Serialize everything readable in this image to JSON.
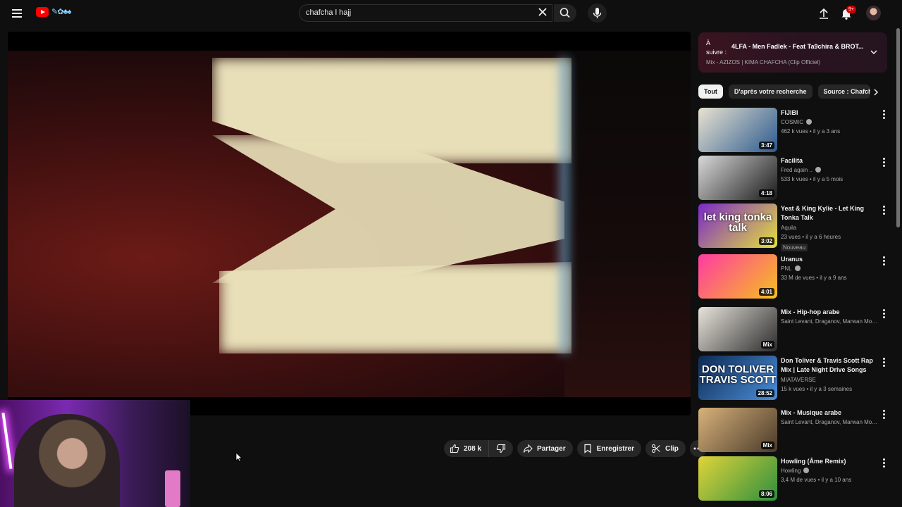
{
  "search": {
    "value": "chafcha l hajj"
  },
  "header": {
    "notification_count": "9+"
  },
  "actions": {
    "likes": "208 k",
    "share_label": "Partager",
    "save_label": "Enregistrer",
    "clip_label": "Clip"
  },
  "up_next": {
    "label": "À suivre :",
    "title": "4LFA - Men Fadlek - Feat Ta9chira & BROT...",
    "playlist": "Mix - AZIZOS | KIMA CHAFCHA (Clip Officiel)"
  },
  "chips": [
    "Tout",
    "D'après votre recherche",
    "Source : Chafcha"
  ],
  "recommendations": [
    {
      "title": "FIJIBI",
      "channel": "COSMIC",
      "verified": true,
      "meta": "462 k vues • il y a 3 ans",
      "duration": "3:47",
      "thumb_colors": [
        "#e9e3d1",
        "#2c5a8f"
      ]
    },
    {
      "title": "Facilita",
      "channel": "Fred again ..",
      "verified": true,
      "meta": "533 k vues • il y a 5 mois",
      "duration": "4:18",
      "thumb_colors": [
        "#d9d9d9",
        "#1a1a1a"
      ]
    },
    {
      "title": "Yeat & King Kylie - Let King Tonka Talk",
      "channel": "Aquila",
      "verified": false,
      "meta": "23 vues • il y a 6 heures",
      "duration": "3:02",
      "badge": "Nouveau",
      "thumb_text": "let king tonka talk",
      "thumb_colors": [
        "#7a28c9",
        "#e6e13a"
      ]
    },
    {
      "title": "Uranus",
      "channel": "PNL",
      "verified": true,
      "meta": "33 M de vues • il y a 9 ans",
      "duration": "4:01",
      "thumb_colors": [
        "#ff3aa3",
        "#f6c11e"
      ]
    },
    {
      "title": "Mix - Hip-hop arabe",
      "channel": "Saint Levant, Draganov, Marwan Moussa...",
      "verified": false,
      "meta": "",
      "duration": "Mix",
      "thumb_colors": [
        "#e8e4dc",
        "#2c2c2c"
      ]
    },
    {
      "title": "Don Toliver & Travis Scott Rap Mix | Late Night Drive Songs",
      "channel": "MIATAVERSE",
      "verified": false,
      "meta": "15 k vues • il y a 3 semaines",
      "duration": "28:52",
      "thumb_text": "DON TOLIVER TRAVIS SCOTT",
      "thumb_colors": [
        "#0d2a55",
        "#4b8fd8"
      ]
    },
    {
      "title": "Mix - Musique arabe",
      "channel": "Saint Levant, Draganov, Marwan Moussa...",
      "verified": false,
      "meta": "",
      "duration": "Mix",
      "thumb_colors": [
        "#d8b27a",
        "#4a3a2a"
      ]
    },
    {
      "title": "Howling (Âme Remix)",
      "channel": "Howling",
      "verified": true,
      "meta": "3,4 M de vues • il y a 10 ans",
      "duration": "8:06",
      "thumb_colors": [
        "#e0d43a",
        "#2e8f3e"
      ]
    }
  ]
}
